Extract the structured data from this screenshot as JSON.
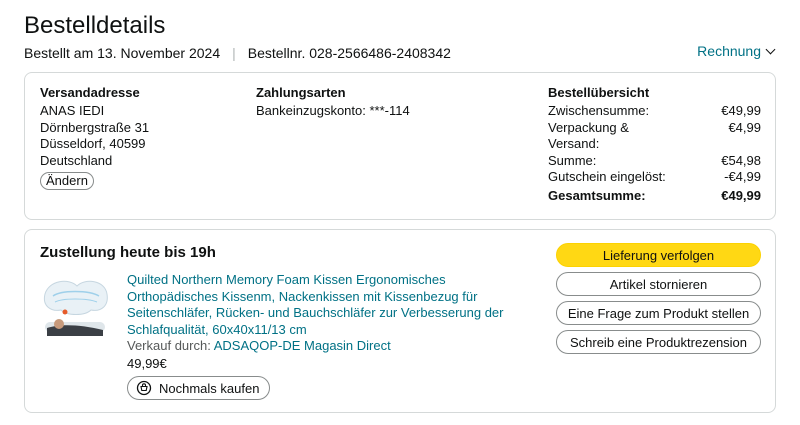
{
  "header": {
    "title": "Bestelldetails",
    "ordered_on": "Bestellt am 13. November 2024",
    "separator": "|",
    "order_number": "Bestellnr. 028-2566486-2408342",
    "invoice_label": "Rechnung"
  },
  "shipping": {
    "title": "Versandadresse",
    "name": "ANAS IEDI",
    "street": "Dörnbergstraße 31",
    "city": "Düsseldorf, 40599",
    "country": "Deutschland",
    "change_label": "Ändern"
  },
  "payment": {
    "title": "Zahlungsarten",
    "method": "Bankeinzugskonto: ***-114"
  },
  "overview": {
    "title": "Bestellübersicht",
    "rows": [
      {
        "label": "Zwischensumme:",
        "value": "€49,99"
      },
      {
        "label": "Verpackung & Versand:",
        "value": "€4,99"
      },
      {
        "label": "Summe:",
        "value": "€54,98"
      },
      {
        "label": "Gutschein eingelöst:",
        "value": "-€4,99"
      }
    ],
    "total": {
      "label": "Gesamtsumme:",
      "value": "€49,99"
    }
  },
  "delivery": {
    "title": "Zustellung heute bis 19h",
    "product": {
      "title": "Quilted Northern Memory Foam Kissen Ergonomisches Orthopädisches Kissenm, Nackenkissen mit Kissenbezug für Seitenschläfer, Rücken- und Bauchschläfer zur Verbesserung der Schlafqualität, 60x40x11/13 cm",
      "seller_prefix": "Verkauf durch:",
      "seller_name": "ADSAQOP-DE Magasin Direct",
      "price": "49,99€",
      "rebuy_label": "Nochmals kaufen"
    },
    "actions": {
      "track": "Lieferung verfolgen",
      "cancel": "Artikel stornieren",
      "question": "Eine Frage zum Produkt stellen",
      "review": "Schreib eine Produktrezension"
    }
  },
  "colors": {
    "link": "#007185",
    "primary_button": "#ffd814",
    "border": "#d5d9d9"
  }
}
